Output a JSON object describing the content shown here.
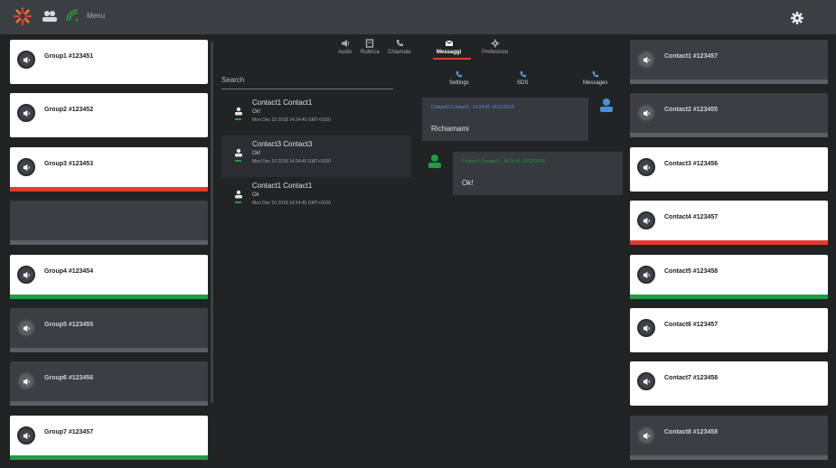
{
  "header": {
    "menu_label": "Menu",
    "logo_icon": "sunburst-logo-icon",
    "users_icon": "people-icon",
    "signal_icon": "wifi-signal-icon",
    "settings_icon": "gear-icon"
  },
  "left_groups": [
    {
      "label": "Group1 #123451",
      "style": "white",
      "bar": "none"
    },
    {
      "label": "Group2 #123452",
      "style": "white",
      "bar": "none"
    },
    {
      "label": "Group3 #123453",
      "style": "white",
      "bar": "red"
    },
    {
      "label": "",
      "style": "dark",
      "bar": "gray"
    },
    {
      "label": "Group4 #123454",
      "style": "white",
      "bar": "green"
    },
    {
      "label": "Group5 #123455",
      "style": "dark",
      "bar": "gray"
    },
    {
      "label": "Group6 #123456",
      "style": "dark",
      "bar": "gray"
    },
    {
      "label": "Group7 #123457",
      "style": "white",
      "bar": "green"
    }
  ],
  "right_contacts": [
    {
      "label": "Contact1 #123457",
      "style": "dark",
      "bar": "gray"
    },
    {
      "label": "Contact2 #123455",
      "style": "dark",
      "bar": "gray"
    },
    {
      "label": "Contact3 #123456",
      "style": "white",
      "bar": "none"
    },
    {
      "label": "Contact4 #123457",
      "style": "white",
      "bar": "red"
    },
    {
      "label": "Contact5 #123458",
      "style": "white",
      "bar": "green"
    },
    {
      "label": "Contact6 #123457",
      "style": "white",
      "bar": "none"
    },
    {
      "label": "Contact7 #123458",
      "style": "white",
      "bar": "none"
    },
    {
      "label": "Contact8 #123458",
      "style": "dark",
      "bar": "gray"
    }
  ],
  "tabs": [
    {
      "label": "Audio",
      "icon": "speaker-icon",
      "active": false
    },
    {
      "label": "Rubrica",
      "icon": "address-book-icon",
      "active": false
    },
    {
      "label": "Chiamate",
      "icon": "phone-icon",
      "active": false
    },
    {
      "label": "Messaggi",
      "icon": "envelope-icon",
      "active": true
    },
    {
      "label": "Preferenze",
      "icon": "gear-icon",
      "active": false
    }
  ],
  "subtabs": [
    {
      "label": "Settings",
      "icon": "phone-settings-icon"
    },
    {
      "label": "SDS",
      "icon": "phone-sds-icon"
    },
    {
      "label": "Messages",
      "icon": "phone-messages-icon"
    }
  ],
  "search": {
    "placeholder": "Search"
  },
  "conversations": [
    {
      "name": "Contact1 Contact1",
      "message": "Ok!",
      "time": "Mon Dec 10 2018 14:24:45 GMT+0100",
      "selected": false
    },
    {
      "name": "Contact3 Contact3",
      "message": "Ok!",
      "time": "Mon Dec 10 2018 14:24:45 GMT+0100",
      "selected": true
    },
    {
      "name": "Contact1 Contact1",
      "message": "Ok",
      "time": "Mon Dec 10 2018 14:24:45 GMT+0100",
      "selected": false
    }
  ],
  "messages": [
    {
      "header": "Contact3 Contact3 - 14:24:45 10/12/2018",
      "body": "Richiamami",
      "side": "left",
      "header_color": "#5b8fd6"
    },
    {
      "header": "Contact1 Contact1 - 14:24:45 10/12/2018",
      "body": "Ok!",
      "side": "right",
      "header_color": "#1f9d44"
    }
  ],
  "colors": {
    "accent": "#e53a2b",
    "ok": "#1f9d44",
    "info": "#4a8fd9"
  }
}
